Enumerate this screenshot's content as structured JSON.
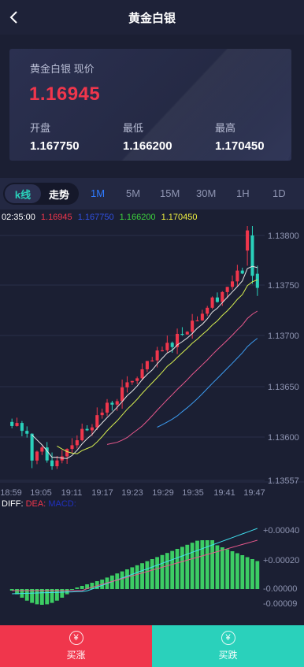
{
  "header": {
    "title": "黄金白银"
  },
  "card": {
    "label": "黄金白银 现价",
    "price": "1.16945",
    "open_label": "开盘",
    "open_value": "1.167750",
    "low_label": "最低",
    "low_value": "1.166200",
    "high_label": "最高",
    "high_value": "1.170450"
  },
  "tabs": {
    "kline": "k线",
    "trend": "走势",
    "periods": [
      "1M",
      "5M",
      "15M",
      "30M",
      "1H",
      "1D"
    ],
    "active_period": "1M"
  },
  "legend": {
    "time": "02:35:00",
    "current": "1.16945",
    "open": "1.167750",
    "low": "1.166200",
    "high": "1.170450"
  },
  "chart_data": {
    "type": "candlestick",
    "y_ticks": [
      "1.13800",
      "1.13750",
      "1.13700",
      "1.13650",
      "1.13600",
      "1.13557"
    ],
    "x_ticks": [
      "18:59",
      "19:05",
      "19:11",
      "19:17",
      "19:23",
      "19:29",
      "19:35",
      "19:41",
      "19:47"
    ],
    "macd_labels": {
      "diff": "DIFF:",
      "dea": "DEA:",
      "macd": "MACD:"
    },
    "macd_ticks": [
      "+0.00040",
      "+0.00020",
      "-0.00000",
      "-0.00009"
    ],
    "colors": {
      "up": "#f0364c",
      "down": "#2ad1bb",
      "ma5": "#e6e6e6",
      "ma10": "#d8f050",
      "ma20": "#e8588c",
      "ma30": "#3c9cf0"
    }
  },
  "buttons": {
    "buy_up": "买涨",
    "buy_down": "买跌"
  },
  "icons": {
    "back": "chevron-left-icon",
    "coin": "yuan-coin-icon"
  }
}
